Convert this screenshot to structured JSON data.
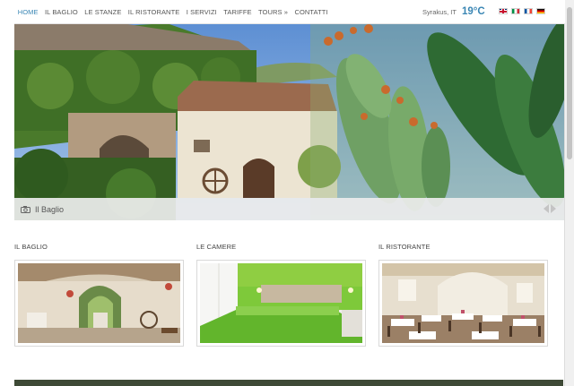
{
  "nav": {
    "items": [
      {
        "label": "HOME",
        "active": true
      },
      {
        "label": "IL BAGLIO"
      },
      {
        "label": "LE STANZE"
      },
      {
        "label": "IL RISTORANTE"
      },
      {
        "label": "I SERVIZI"
      },
      {
        "label": "TARIFFE"
      },
      {
        "label": "TOURS »"
      },
      {
        "label": "CONTATTI"
      }
    ]
  },
  "weather": {
    "city": "Syrakus, IT",
    "temperature": "19°C"
  },
  "flags": [
    "uk-flag",
    "italy-flag",
    "france-flag",
    "germany-flag"
  ],
  "hero": {
    "caption": "Il Baglio",
    "icon": "camera-icon"
  },
  "sections": [
    {
      "title": "IL BAGLIO"
    },
    {
      "title": "LE CAMERE"
    },
    {
      "title": "IL RISTORANTE"
    }
  ],
  "colors": {
    "accent": "#3a86b4"
  }
}
